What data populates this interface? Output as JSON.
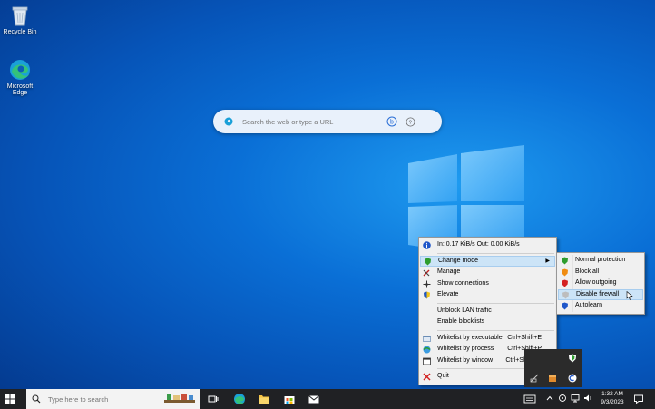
{
  "desktop": {
    "icons": [
      {
        "label": "Recycle Bin",
        "icon": "recycle-bin-icon"
      },
      {
        "label": "Microsoft Edge",
        "icon": "edge-icon"
      }
    ]
  },
  "search_bar": {
    "placeholder": "Search the web or type a URL"
  },
  "context_menu": {
    "status": "In: 0.17 KiB/s   Out: 0.00 KiB/s",
    "change_mode": "Change mode",
    "manage": "Manage",
    "show_connections": "Show connections",
    "elevate": "Elevate",
    "unblock_lan": "Unblock LAN traffic",
    "enable_blocklists": "Enable blocklists",
    "whitelist_executable": "Whitelist by executable",
    "whitelist_executable_shortcut": "Ctrl+Shift+E",
    "whitelist_process": "Whitelist by process",
    "whitelist_process_shortcut": "Ctrl+Shift+P",
    "whitelist_window": "Whitelist by window",
    "whitelist_window_shortcut": "Ctrl+Shift+W",
    "quit": "Quit"
  },
  "submenu": {
    "normal_protection": "Normal protection",
    "block_all": "Block all",
    "allow_outgoing": "Allow outgoing",
    "disable_firewall": "Disable firewall",
    "autolearn": "Autolearn"
  },
  "taskbar": {
    "search_placeholder": "Type here to search",
    "time": "1:32 AM",
    "date": "9/3/2023"
  },
  "colors": {
    "menu_highlight": "#cce4f7",
    "taskbar": "#202124",
    "shield_green": "#2e9d2e",
    "shield_orange": "#f08c12",
    "shield_red": "#d42020",
    "shield_blue": "#1f56c9"
  }
}
